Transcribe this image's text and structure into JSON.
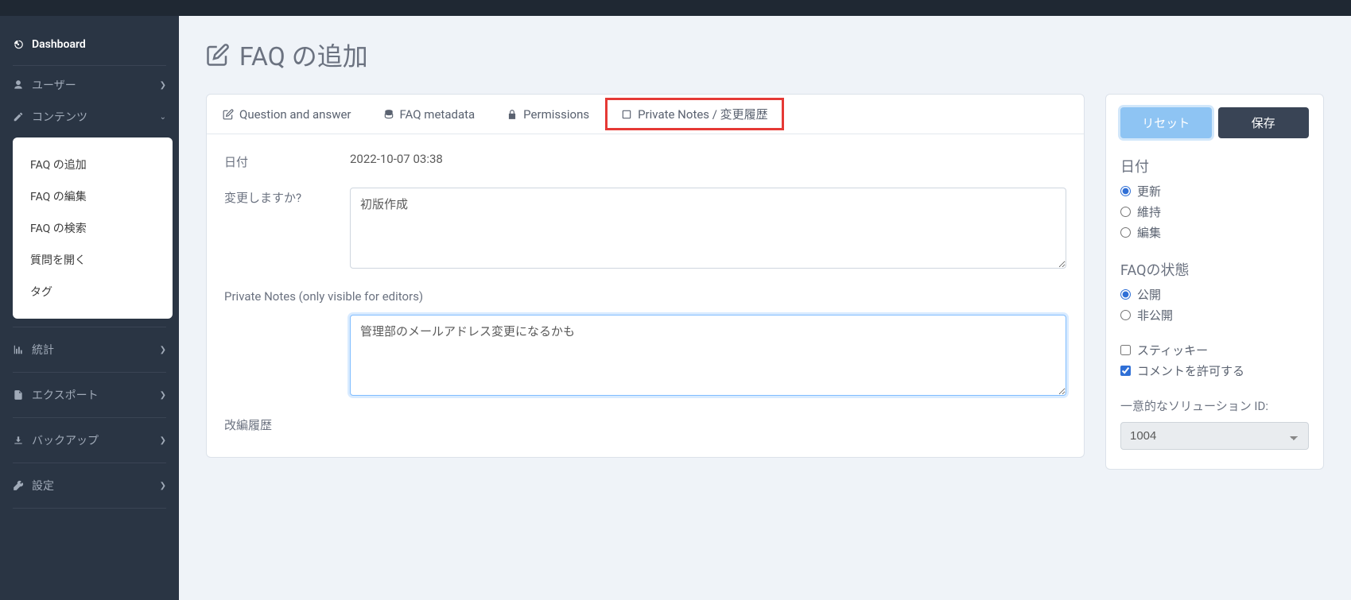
{
  "sidebar": {
    "dashboard": "Dashboard",
    "users": "ユーザー",
    "contents": "コンテンツ",
    "sub": {
      "add_faq": "FAQ の追加",
      "edit_faq": "FAQ の編集",
      "search_faq": "FAQ の検索",
      "open_question": "質問を開く",
      "tag": "タグ"
    },
    "stats": "統計",
    "export": "エクスポート",
    "backup": "バックアップ",
    "settings": "設定"
  },
  "page": {
    "title": "FAQ の追加"
  },
  "tabs": {
    "qa": "Question and answer",
    "metadata": "FAQ metadata",
    "permissions": "Permissions",
    "private_notes": "Private Notes / 変更履歴"
  },
  "form": {
    "date_label": "日付",
    "date_value": "2022-10-07 03:38",
    "change_label": "変更しますか?",
    "change_value": "初版作成",
    "private_notes_label": "Private Notes (only visible for editors)",
    "private_notes_value": "管理部のメールアドレス変更になるかも",
    "history_label": "改編履歴"
  },
  "side": {
    "reset": "リセット",
    "save": "保存",
    "date_heading": "日付",
    "date_update": "更新",
    "date_keep": "維持",
    "date_edit": "編集",
    "state_heading": "FAQの状態",
    "state_public": "公開",
    "state_private": "非公開",
    "sticky": "スティッキー",
    "allow_comments": "コメントを許可する",
    "solution_id_label": "一意的なソリューション ID:",
    "solution_id_value": "1004"
  }
}
